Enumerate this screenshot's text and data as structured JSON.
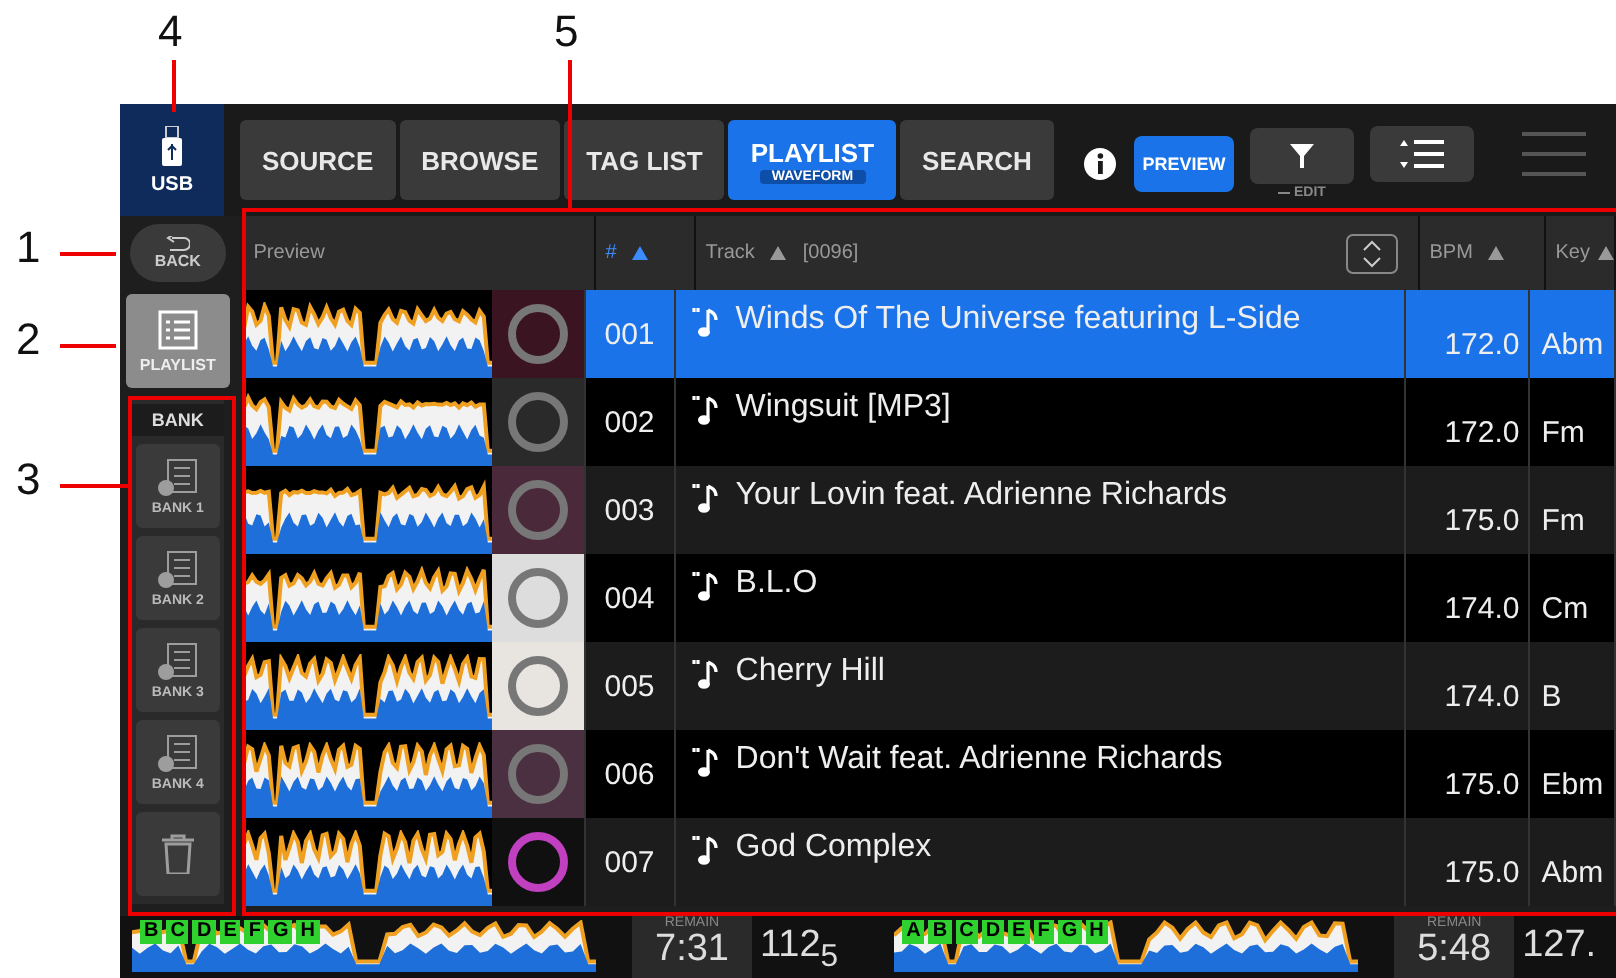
{
  "callouts": [
    "1",
    "2",
    "3",
    "4",
    "5"
  ],
  "source": {
    "label": "USB"
  },
  "sidebar": {
    "back": "BACK",
    "playlist": {
      "label": "PLAYLIST",
      "selected": true
    },
    "bank": {
      "title": "BANK",
      "items": [
        {
          "label": "BANK 1",
          "disabled": true
        },
        {
          "label": "BANK 2",
          "disabled": true
        },
        {
          "label": "BANK 3",
          "disabled": true
        },
        {
          "label": "BANK 4",
          "disabled": true
        }
      ]
    },
    "trash_disabled": true
  },
  "tabs": [
    {
      "label": "SOURCE",
      "selected": false
    },
    {
      "label": "BROWSE",
      "selected": false
    },
    {
      "label": "TAG LIST",
      "selected": false
    },
    {
      "label": "PLAYLIST",
      "selected": true,
      "sublabel": "WAVEFORM"
    },
    {
      "label": "SEARCH",
      "selected": false
    }
  ],
  "toolbar": {
    "preview": {
      "label": "PREVIEW",
      "on": true
    },
    "filter": {
      "sublabel": "EDIT"
    }
  },
  "table": {
    "columns": {
      "preview": "Preview",
      "number": "#",
      "track": "Track",
      "count": "[0096]",
      "bpm": "BPM",
      "key": "Key"
    },
    "rows": [
      {
        "number": "001",
        "title": "Winds Of The Universe featuring L-Side",
        "bpm": "172.0",
        "key": "Abm",
        "selected": true
      },
      {
        "number": "002",
        "title": "Wingsuit [MP3]",
        "bpm": "172.0",
        "key": "Fm",
        "selected": false
      },
      {
        "number": "003",
        "title": "Your Lovin feat. Adrienne Richards",
        "bpm": "175.0",
        "key": "Fm",
        "selected": false
      },
      {
        "number": "004",
        "title": "B.L.O",
        "bpm": "174.0",
        "key": "Cm",
        "selected": false
      },
      {
        "number": "005",
        "title": "Cherry Hill",
        "bpm": "174.0",
        "key": "B",
        "selected": false
      },
      {
        "number": "006",
        "title": "Don't Wait feat. Adrienne Richards",
        "bpm": "175.0",
        "key": "Ebm",
        "selected": false
      },
      {
        "number": "007",
        "title": "God Complex",
        "bpm": "175.0",
        "key": "Abm",
        "selected": false
      }
    ]
  },
  "decks": [
    {
      "cues": [
        "B",
        "C",
        "D",
        "E",
        "F",
        "G",
        "H"
      ],
      "remain_label": "REMAIN",
      "time": "7:31",
      "bpm": "112$_{5}$"
    },
    {
      "cues": [
        "A",
        "B",
        "C",
        "D",
        "E",
        "F",
        "G",
        "H"
      ],
      "remain_label": "REMAIN",
      "time": "5:48",
      "bpm": "127."
    }
  ]
}
